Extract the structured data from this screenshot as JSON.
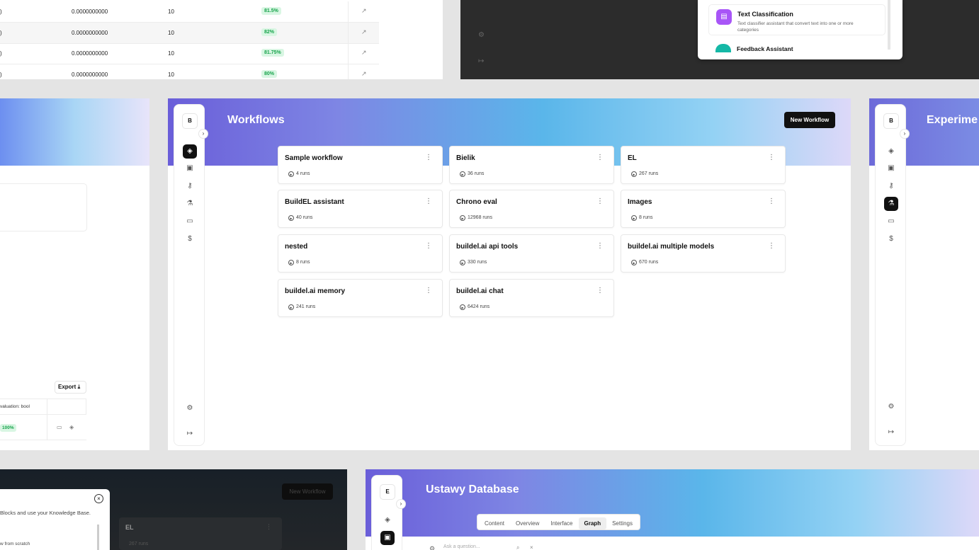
{
  "table": {
    "rows": [
      {
        "c1": ")",
        "value": "0.0000000000",
        "count": "10",
        "score": "81.5%"
      },
      {
        "c1": ")",
        "value": "0.0000000000",
        "count": "10",
        "score": "82%"
      },
      {
        "c1": ")",
        "value": "0.0000000000",
        "count": "10",
        "score": "81.75%"
      },
      {
        "c1": ")",
        "value": "0.0000000000",
        "count": "10",
        "score": "80%"
      }
    ]
  },
  "dark_popup": {
    "card1_title": "Text Classification",
    "card1_desc": "Text classifier assistant that convert text into one or more categories",
    "card2_title": "Feedback Assistant"
  },
  "midleft": {
    "export_label": "Export",
    "col_label": "valuation: bool",
    "badge": "100%"
  },
  "main": {
    "logo_letter": "B",
    "title": "Workflows",
    "new_button": "New Workflow",
    "cards": [
      {
        "name": "Sample workflow",
        "runs": "4 runs"
      },
      {
        "name": "Bielik",
        "runs": "36 runs"
      },
      {
        "name": "EL",
        "runs": "267 runs"
      },
      {
        "name": "BuildEL assistant",
        "runs": "40 runs"
      },
      {
        "name": "Chrono eval",
        "runs": "12968 runs"
      },
      {
        "name": "Images",
        "runs": "8 runs"
      },
      {
        "name": "nested",
        "runs": "8 runs"
      },
      {
        "name": "buildel.ai api tools",
        "runs": "330 runs"
      },
      {
        "name": "buildel.ai multiple models",
        "runs": "670 runs"
      },
      {
        "name": "buildel.ai memory",
        "runs": "241 runs"
      },
      {
        "name": "buildel.ai chat",
        "runs": "6424 runs"
      }
    ]
  },
  "midright": {
    "logo_letter": "B",
    "title": "Experime"
  },
  "botleft": {
    "modal_text": "Blocks and use your Knowledge Base.",
    "modal_option": "w from scratch",
    "card_name": "EL",
    "card_runs": "267 runs",
    "new_button": "New Workflow"
  },
  "botright": {
    "logo_letter": "E",
    "title": "Ustawy Database",
    "tabs": [
      "Content",
      "Overview",
      "Interface",
      "Graph",
      "Settings"
    ],
    "search_placeholder": "Ask a question..."
  }
}
